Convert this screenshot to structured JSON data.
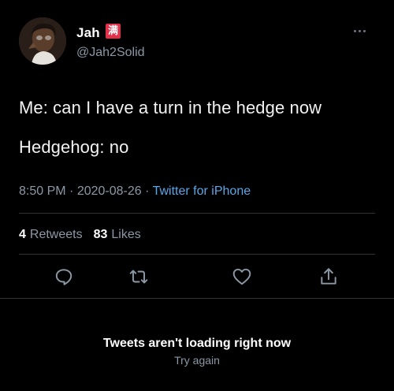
{
  "author": {
    "display_name": "Jah",
    "badge": "满",
    "handle": "@Jah2Solid",
    "avatar_icon": "profile-photo"
  },
  "tweet": {
    "lines": [
      "Me: can I have a turn in the hedge now",
      "Hedgehog: no"
    ],
    "time": "8:50 PM",
    "date": "2020-08-26",
    "source": "Twitter for iPhone"
  },
  "stats": {
    "retweets_count": "4",
    "retweets_label": "Retweets",
    "likes_count": "83",
    "likes_label": "Likes"
  },
  "actions": {
    "icons": [
      "reply-icon",
      "retweet-icon",
      "like-icon",
      "share-icon"
    ]
  },
  "error": {
    "title": "Tweets aren't loading right now",
    "retry": "Try again"
  },
  "colors": {
    "background": "#000000",
    "text": "#e7e9ea",
    "secondary": "#8b98a5",
    "link": "#5aa7e8",
    "badge": "#e0304a"
  }
}
